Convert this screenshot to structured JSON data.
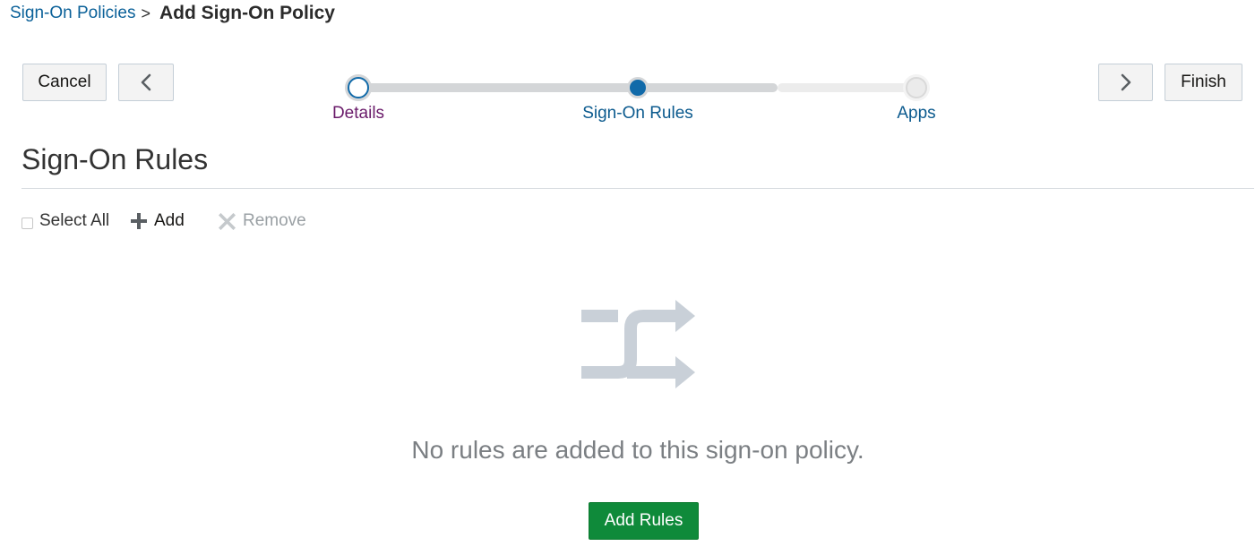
{
  "breadcrumb": {
    "parent": "Sign-On Policies",
    "separator": ">",
    "current": "Add Sign-On Policy"
  },
  "buttons": {
    "cancel": "Cancel",
    "previous_icon": "chevron-left-icon",
    "next_icon": "chevron-right-icon",
    "finish": "Finish"
  },
  "train": {
    "steps": [
      {
        "label": "Details",
        "state": "visited"
      },
      {
        "label": "Sign-On Rules",
        "state": "current"
      },
      {
        "label": "Apps",
        "state": "unvisited"
      }
    ]
  },
  "section": {
    "title": "Sign-On Rules"
  },
  "toolbar": {
    "select_all": "Select All",
    "add": "Add",
    "add_icon": "plus-icon",
    "remove": "Remove",
    "remove_icon": "close-icon"
  },
  "empty_state": {
    "icon": "shuffle-icon",
    "message": "No rules are added to this sign-on policy.",
    "action": "Add Rules"
  },
  "colors": {
    "link": "#0b6199",
    "visited_step": "#6a1b6a",
    "current_step": "#116aa9",
    "primary_button": "#0f8a3a",
    "disabled_text": "#9aa0a4",
    "empty_icon": "#c9d0d8"
  }
}
